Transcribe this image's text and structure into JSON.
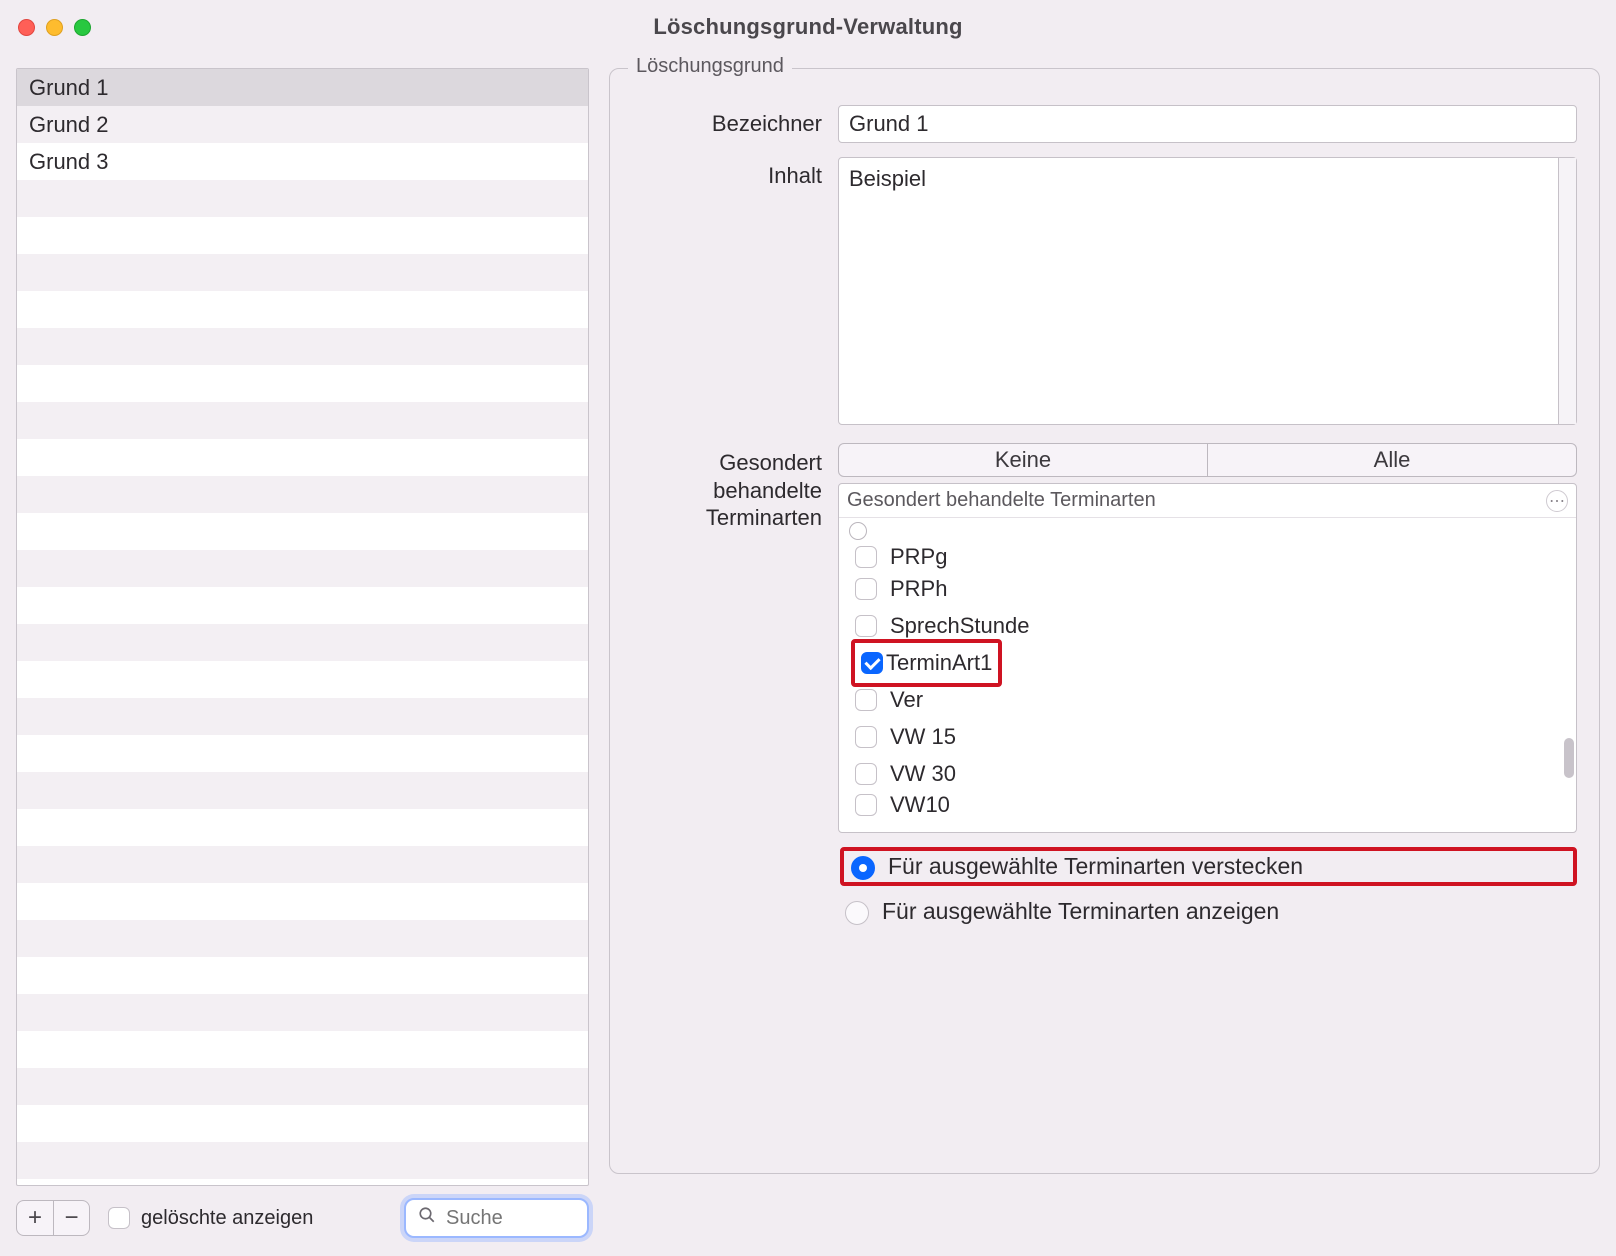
{
  "window": {
    "title": "Löschungsgrund-Verwaltung"
  },
  "sidebar": {
    "items": [
      {
        "label": "Grund 1",
        "selected": true
      },
      {
        "label": "Grund 2",
        "selected": false
      },
      {
        "label": "Grund 3",
        "selected": false
      }
    ],
    "blank_rows": 29,
    "footer": {
      "add": "+",
      "remove": "−",
      "show_deleted_label": "gelöschte anzeigen",
      "show_deleted_checked": false,
      "search_placeholder": "Suche",
      "search_value": ""
    }
  },
  "panel": {
    "legend": "Löschungsgrund",
    "labels": {
      "bezeichner": "Bezeichner",
      "inhalt": "Inhalt",
      "terminarten_l1": "Gesondert",
      "terminarten_l2": "behandelte",
      "terminarten_l3": "Terminarten"
    },
    "bezeichner_value": "Grund 1",
    "inhalt_value": "Beispiel",
    "terminarten": {
      "seg_none": "Keine",
      "seg_all": "Alle",
      "list_header": "Gesondert behandelte Terminarten",
      "items": [
        {
          "label": "PRPg",
          "checked": false,
          "partial": true
        },
        {
          "label": "PRPh",
          "checked": false
        },
        {
          "label": "SprechStunde",
          "checked": false
        },
        {
          "label": "TerminArt1",
          "checked": true,
          "highlight": true
        },
        {
          "label": "Ver",
          "checked": false
        },
        {
          "label": "VW 15",
          "checked": false
        },
        {
          "label": "VW 30",
          "checked": false
        },
        {
          "label": "VW10",
          "checked": false,
          "partial": true
        }
      ]
    },
    "radios": {
      "hide_label": "Für ausgewählte Terminarten verstecken",
      "show_label": "Für ausgewählte Terminarten anzeigen",
      "selected": "hide"
    }
  }
}
